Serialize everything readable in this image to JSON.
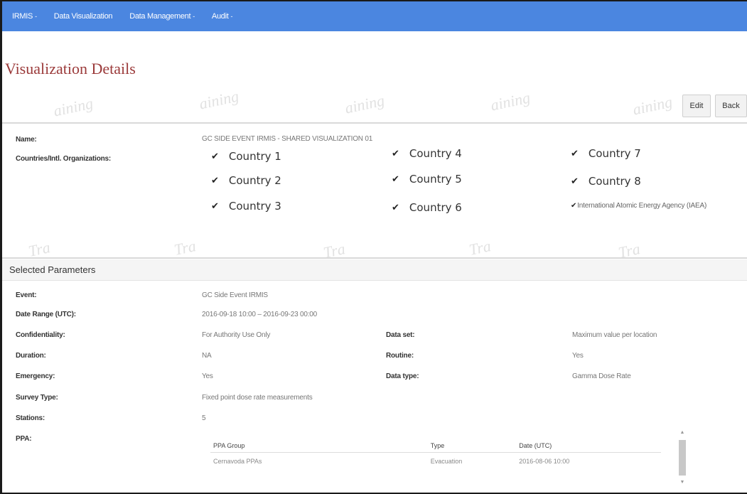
{
  "nav": {
    "items": [
      {
        "label": "IRMIS",
        "caret": "-"
      },
      {
        "label": "Data Visualization",
        "caret": ""
      },
      {
        "label": "Data Management",
        "caret": "-"
      },
      {
        "label": "Audit",
        "caret": "-"
      }
    ]
  },
  "page": {
    "title": "Visualization Details",
    "watermark_top": "aining",
    "watermark_bottom": "Tra"
  },
  "actions": {
    "edit_label": "Edit",
    "back_label": "Back"
  },
  "details": {
    "name_label": "Name:",
    "name_value": "GC SIDE EVENT IRMIS - SHARED VISUALIZATION 01",
    "countries_label": "Countries/Intl. Organizations:",
    "check_glyph": "✔",
    "countries": [
      "Country 1",
      "Country 2",
      "Country 3",
      "Country 4",
      "Country 5",
      "Country 6",
      "Country 7",
      "Country 8",
      "International Atomic Energy Agency (IAEA)"
    ]
  },
  "parameters": {
    "header": "Selected Parameters",
    "event_label": "Event:",
    "event_value": "GC Side Event IRMIS",
    "date_range_label": "Date Range (UTC):",
    "date_range_value": "2016-09-18 10:00 – 2016-09-23 00:00",
    "confidentiality_label": "Confidentiality:",
    "confidentiality_value": "For Authority Use Only",
    "data_set_label": "Data set:",
    "data_set_value": "Maximum value per location",
    "duration_label": "Duration:",
    "duration_value": "NA",
    "routine_label": "Routine:",
    "routine_value": "Yes",
    "emergency_label": "Emergency:",
    "emergency_value": "Yes",
    "data_type_label": "Data type:",
    "data_type_value": "Gamma Dose Rate",
    "survey_type_label": "Survey Type:",
    "survey_type_value": "Fixed point dose rate measurements",
    "stations_label": "Stations:",
    "stations_value": "5",
    "ppa_label": "PPA:"
  },
  "ppa_table": {
    "columns": [
      "PPA Group",
      "Type",
      "Date (UTC)"
    ],
    "rows": [
      [
        "Cernavoda PPAs",
        "Evacuation",
        "2016-08-06 10:00"
      ]
    ]
  },
  "colors": {
    "navbar": "#4b86e0",
    "title": "#9b3a3a"
  }
}
